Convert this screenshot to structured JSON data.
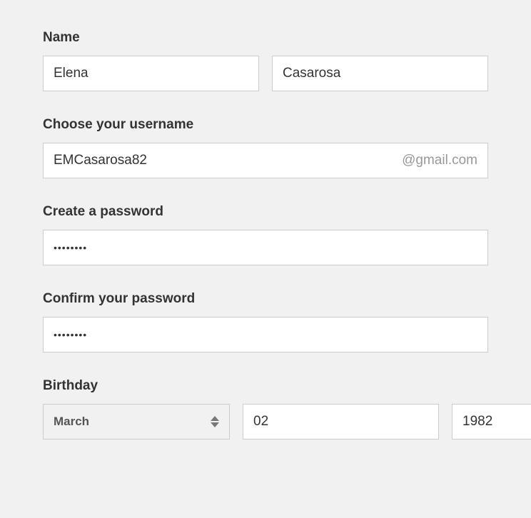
{
  "labels": {
    "name": "Name",
    "username": "Choose your username",
    "password": "Create a password",
    "confirm": "Confirm your password",
    "birthday": "Birthday"
  },
  "name": {
    "first": "Elena",
    "last": "Casarosa"
  },
  "username": {
    "value": "EMCasarosa82",
    "suffix": "@gmail.com"
  },
  "password": {
    "value": "••••••••"
  },
  "confirm": {
    "value": "••••••••"
  },
  "birthday": {
    "month": "March",
    "day": "02",
    "year": "1982"
  }
}
